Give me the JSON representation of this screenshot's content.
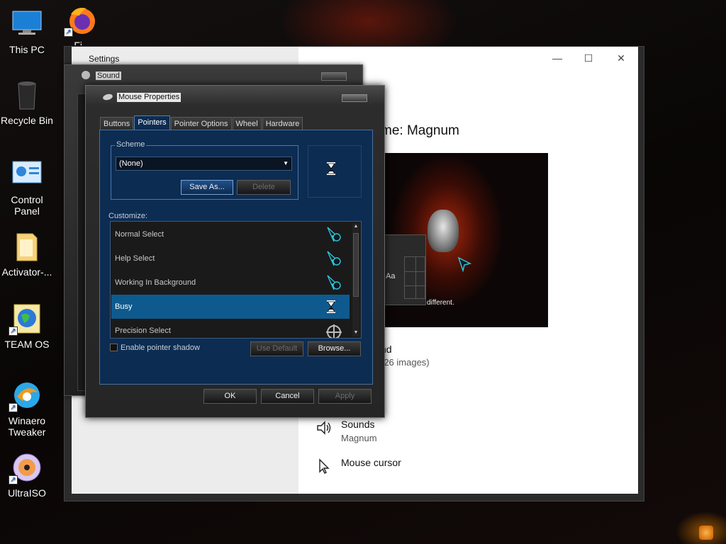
{
  "desktop": {
    "icons": [
      {
        "label": "This PC"
      },
      {
        "label": "Fi..."
      },
      {
        "label": "Recycle Bin"
      },
      {
        "label": "Control Panel"
      },
      {
        "label": "Activator-..."
      },
      {
        "label": "TEAM OS"
      },
      {
        "label": "Winaero Tweaker"
      },
      {
        "label": "UltraISO"
      }
    ]
  },
  "settings": {
    "title": "Settings",
    "theme_title": "me: Magnum",
    "preview_text": "different.",
    "preview_sample": "Aa",
    "background_label": "nd",
    "background_sub": "(26 images)",
    "sounds_label": "Sounds",
    "sounds_value": "Magnum",
    "cursor_label": "Mouse cursor"
  },
  "sound": {
    "title": "Sound"
  },
  "mouse": {
    "title": "Mouse Properties",
    "tabs": [
      {
        "label": "Buttons"
      },
      {
        "label": "Pointers"
      },
      {
        "label": "Pointer Options"
      },
      {
        "label": "Wheel"
      },
      {
        "label": "Hardware"
      }
    ],
    "scheme": {
      "legend": "Scheme",
      "selected": "(None)",
      "save_as": "Save As...",
      "delete": "Delete"
    },
    "customize_label": "Customize:",
    "pointers": [
      {
        "label": "Normal Select",
        "icon": "cursor-arrow-icon"
      },
      {
        "label": "Help Select",
        "icon": "cursor-arrow-icon"
      },
      {
        "label": "Working In Background",
        "icon": "cursor-arrow-icon"
      },
      {
        "label": "Busy",
        "icon": "hourglass-icon"
      },
      {
        "label": "Precision Select",
        "icon": "crosshair-icon"
      }
    ],
    "enable_shadow": "Enable pointer shadow",
    "use_default": "Use Default",
    "browse": "Browse...",
    "ok": "OK",
    "cancel": "Cancel",
    "apply": "Apply"
  },
  "colors": {
    "panel_blue": "#0d2c52",
    "selection_blue": "#0e5a8e",
    "cursor_teal": "#2fc5d8"
  }
}
